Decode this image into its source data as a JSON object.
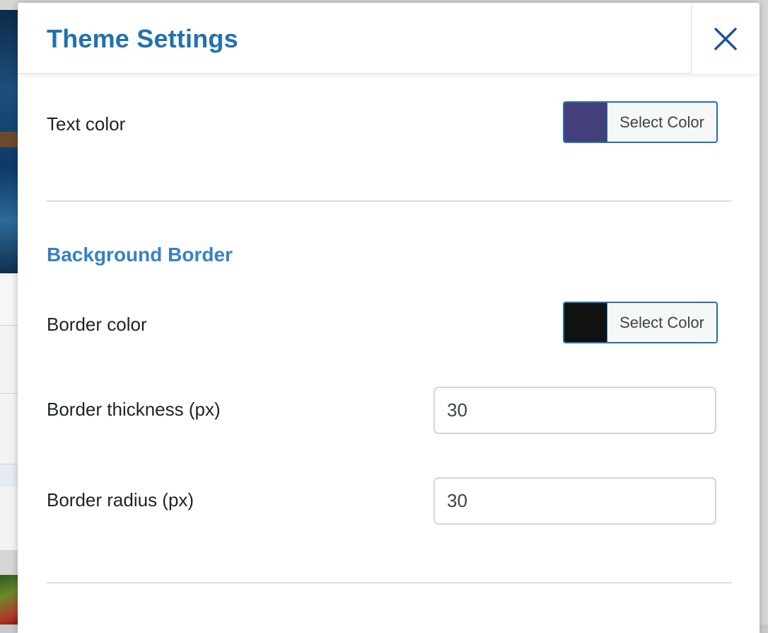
{
  "modal": {
    "title": "Theme Settings",
    "close_icon": "close-icon"
  },
  "text_color": {
    "label": "Text color",
    "swatch_color": "#433f7a",
    "button_label": "Select Color"
  },
  "background_border": {
    "heading": "Background Border",
    "border_color": {
      "label": "Border color",
      "swatch_color": "#111111",
      "button_label": "Select Color"
    },
    "border_thickness": {
      "label": "Border thickness (px)",
      "value": "30"
    },
    "border_radius": {
      "label": "Border radius (px)",
      "value": "30"
    }
  },
  "colors": {
    "accent": "#2271b1",
    "heading_blue": "#3582c4"
  }
}
